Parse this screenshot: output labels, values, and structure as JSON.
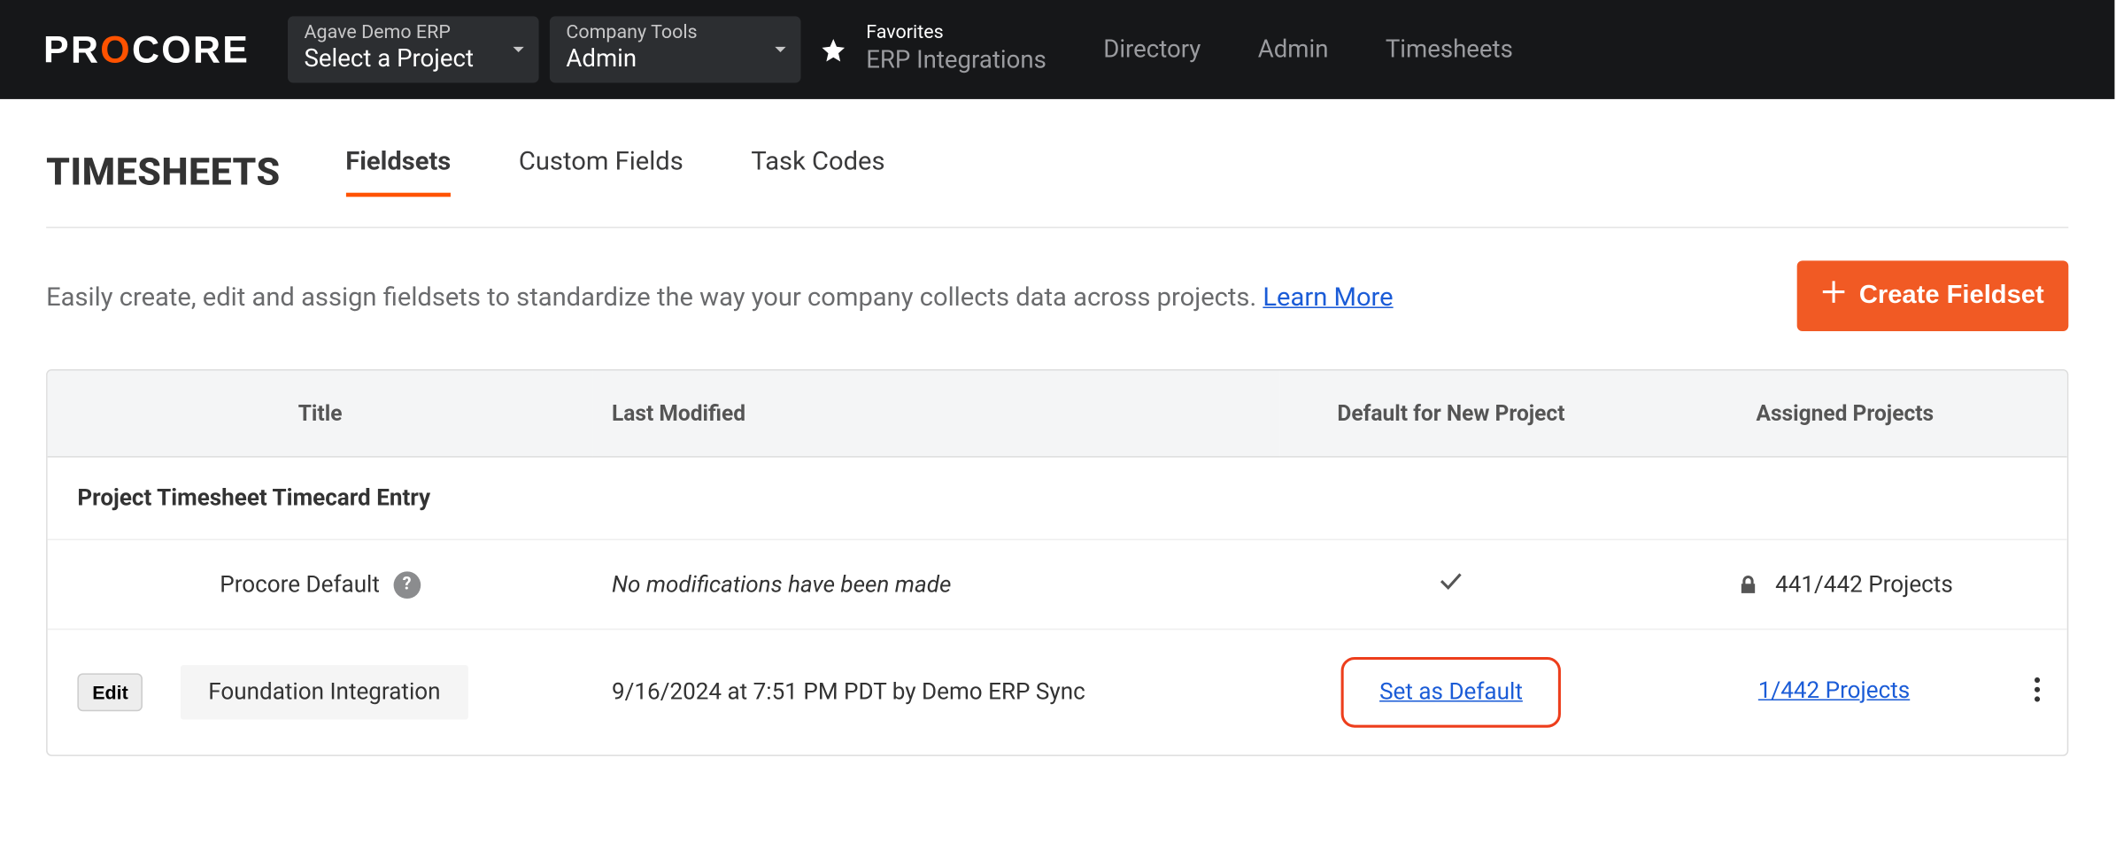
{
  "header": {
    "project_selector": {
      "top": "Agave Demo ERP",
      "bottom": "Select a Project"
    },
    "tools_selector": {
      "top": "Company Tools",
      "bottom": "Admin"
    },
    "favorites_label": "Favorites",
    "favorites_link": "ERP Integrations",
    "nav": [
      "Directory",
      "Admin",
      "Timesheets"
    ]
  },
  "page": {
    "title": "TIMESHEETS",
    "tabs": [
      "Fieldsets",
      "Custom Fields",
      "Task Codes"
    ],
    "description": "Easily create, edit and assign fieldsets to standardize the way your company collects data across projects. ",
    "learn_more": "Learn More",
    "create_button": "Create Fieldset"
  },
  "table": {
    "columns": {
      "title": "Title",
      "modified": "Last Modified",
      "default": "Default for New Project",
      "projects": "Assigned Projects"
    },
    "section": "Project Timesheet Timecard Entry",
    "rows": [
      {
        "title": "Procore Default",
        "has_help": true,
        "modified": "No modifications have been made",
        "modified_italic": true,
        "is_default": true,
        "set_default_label": "",
        "locked": true,
        "projects": "441/442 Projects",
        "projects_link": false,
        "editable": false
      },
      {
        "title": "Foundation Integration",
        "has_help": false,
        "modified": "9/16/2024 at 7:51 PM PDT by Demo ERP Sync",
        "modified_italic": false,
        "is_default": false,
        "set_default_label": "Set as Default",
        "locked": false,
        "projects": "1/442 Projects",
        "projects_link": true,
        "editable": true,
        "edit_label": "Edit"
      }
    ]
  }
}
